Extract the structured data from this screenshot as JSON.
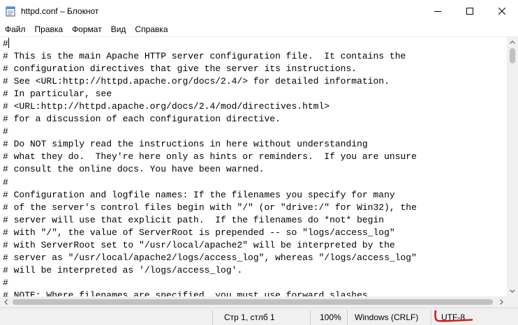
{
  "window": {
    "title": "httpd.conf – Блокнот",
    "app_icon": "notepad-icon",
    "controls": {
      "minimize": "minimize-icon",
      "maximize": "maximize-icon",
      "close": "close-icon"
    }
  },
  "menu": [
    {
      "label": "Файл"
    },
    {
      "label": "Правка"
    },
    {
      "label": "Формат"
    },
    {
      "label": "Вид"
    },
    {
      "label": "Справка"
    }
  ],
  "editor": {
    "first_line": "#",
    "text": "# This is the main Apache HTTP server configuration file.  It contains the\n# configuration directives that give the server its instructions.\n# See <URL:http://httpd.apache.org/docs/2.4/> for detailed information.\n# In particular, see\n# <URL:http://httpd.apache.org/docs/2.4/mod/directives.html>\n# for a discussion of each configuration directive.\n#\n# Do NOT simply read the instructions in here without understanding\n# what they do.  They're here only as hints or reminders.  If you are unsure\n# consult the online docs. You have been warned.\n#\n# Configuration and logfile names: If the filenames you specify for many\n# of the server's control files begin with \"/\" (or \"drive:/\" for Win32), the\n# server will use that explicit path.  If the filenames do *not* begin\n# with \"/\", the value of ServerRoot is prepended -- so \"logs/access_log\"\n# with ServerRoot set to \"/usr/local/apache2\" will be interpreted by the\n# server as \"/usr/local/apache2/logs/access_log\", whereas \"/logs/access_log\"\n# will be interpreted as '/logs/access_log'.\n#\n# NOTE: Where filenames are specified, you must use forward slashes"
  },
  "status": {
    "position": "Стр 1, стлб 1",
    "zoom": "100%",
    "line_endings": "Windows (CRLF)",
    "encoding": "UTF-8"
  },
  "colors": {
    "annotation_mark": "#d21e1e",
    "scroll_thumb": "#c1c1c1",
    "chrome": "#f0f0f0"
  }
}
